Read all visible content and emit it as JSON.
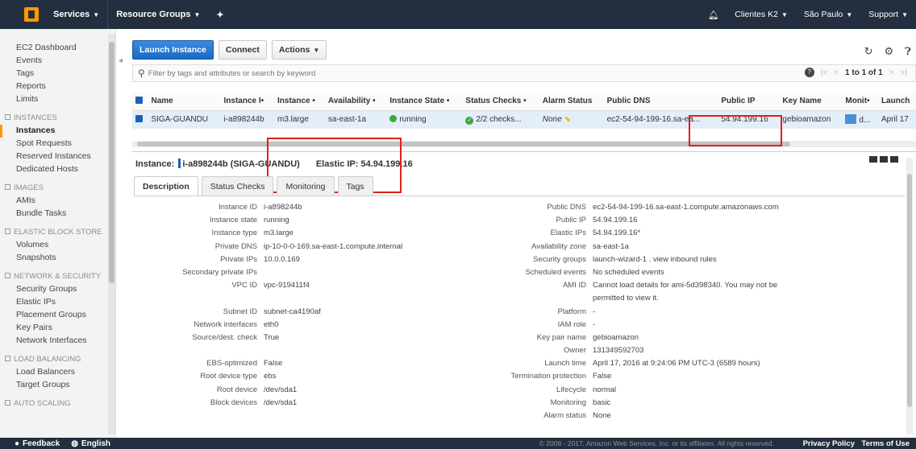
{
  "topbar": {
    "services": "Services",
    "resource_groups": "Resource Groups",
    "account": "Clientes K2",
    "region": "São Paulo",
    "support": "Support"
  },
  "sidebar": {
    "items": [
      {
        "label": "EC2 Dashboard",
        "type": "item"
      },
      {
        "label": "Events",
        "type": "item"
      },
      {
        "label": "Tags",
        "type": "item"
      },
      {
        "label": "Reports",
        "type": "item"
      },
      {
        "label": "Limits",
        "type": "item"
      },
      {
        "label": "INSTANCES",
        "type": "section"
      },
      {
        "label": "Instances",
        "type": "active"
      },
      {
        "label": "Spot Requests",
        "type": "item"
      },
      {
        "label": "Reserved Instances",
        "type": "item"
      },
      {
        "label": "Dedicated Hosts",
        "type": "item"
      },
      {
        "label": "IMAGES",
        "type": "section"
      },
      {
        "label": "AMIs",
        "type": "item"
      },
      {
        "label": "Bundle Tasks",
        "type": "item"
      },
      {
        "label": "ELASTIC BLOCK STORE",
        "type": "section"
      },
      {
        "label": "Volumes",
        "type": "item"
      },
      {
        "label": "Snapshots",
        "type": "item"
      },
      {
        "label": "NETWORK & SECURITY",
        "type": "section"
      },
      {
        "label": "Security Groups",
        "type": "item"
      },
      {
        "label": "Elastic IPs",
        "type": "item"
      },
      {
        "label": "Placement Groups",
        "type": "item"
      },
      {
        "label": "Key Pairs",
        "type": "item"
      },
      {
        "label": "Network Interfaces",
        "type": "item"
      },
      {
        "label": "LOAD BALANCING",
        "type": "section"
      },
      {
        "label": "Load Balancers",
        "type": "item"
      },
      {
        "label": "Target Groups",
        "type": "item"
      },
      {
        "label": "AUTO SCALING",
        "type": "section"
      }
    ]
  },
  "toolbar": {
    "launch": "Launch Instance",
    "connect": "Connect",
    "actions": "Actions"
  },
  "filter": {
    "placeholder": "Filter by tags and attributes or search by keyword",
    "pager": "1 to 1 of 1"
  },
  "table": {
    "headers": [
      "Name",
      "Instance I•",
      "Instance •",
      "Availability •",
      "Instance State •",
      "Status Checks •",
      "Alarm Status",
      "Public DNS",
      "Public IP",
      "Key Name",
      "Monit•",
      "Launch"
    ],
    "row": {
      "name": "SIGA-GUANDU",
      "instance_id": "i-a898244b",
      "instance_type": "m3.large",
      "az": "sa-east-1a",
      "state": "running",
      "status_checks": "2/2 checks...",
      "alarm": "None",
      "public_dns": "ec2-54-94-199-16.sa-ea...",
      "public_ip": "54.94.199.16",
      "key_name": "gebioamazon",
      "monitoring": "d...",
      "launch": "April 17"
    }
  },
  "detail": {
    "instance_label": "Instance:",
    "instance_value": "i-a898244b (SIGA-GUANDU)",
    "elastic_ip": "Elastic IP: 54.94.199.16",
    "tabs": [
      "Description",
      "Status Checks",
      "Monitoring",
      "Tags"
    ],
    "left": [
      {
        "label": "Instance ID",
        "value": "i-a898244b"
      },
      {
        "label": "Instance state",
        "value": "running"
      },
      {
        "label": "Instance type",
        "value": "m3.large"
      },
      {
        "label": "Private DNS",
        "value": "ip-10-0-0-169.sa-east-1.compute.internal"
      },
      {
        "label": "Private IPs",
        "value": "10.0.0.169"
      },
      {
        "label": "Secondary private IPs",
        "value": ""
      },
      {
        "label": "VPC ID",
        "value": "vpc-919411f4"
      },
      {
        "label": "",
        "value": ""
      },
      {
        "label": "Subnet ID",
        "value": "subnet-ca4190af"
      },
      {
        "label": "Network interfaces",
        "value": "eth0",
        "link": true
      },
      {
        "label": "Source/dest. check",
        "value": "True"
      },
      {
        "label": "",
        "value": ""
      },
      {
        "label": "EBS-optimized",
        "value": "False"
      },
      {
        "label": "Root device type",
        "value": "ebs"
      },
      {
        "label": "Root device",
        "value": "/dev/sda1",
        "link": true
      },
      {
        "label": "Block devices",
        "value": "/dev/sda1",
        "link": true
      }
    ],
    "right": [
      {
        "label": "Public DNS",
        "value": "ec2-54-94-199-16.sa-east-1.compute.amazonaws.com"
      },
      {
        "label": "Public IP",
        "value": "54.94.199.16",
        "link": true
      },
      {
        "label": "Elastic IPs",
        "value": "54.94.199.16*",
        "link": true
      },
      {
        "label": "Availability zone",
        "value": "sa-east-1a"
      },
      {
        "label": "Security groups",
        "value": "launch-wizard-1 . view inbound rules",
        "link": true
      },
      {
        "label": "Scheduled events",
        "value": "No scheduled events",
        "link": true
      },
      {
        "label": "AMI ID",
        "value": "Cannot load details for ami-5d398340. You may not be"
      },
      {
        "label": "",
        "value": "permitted to view it."
      },
      {
        "label": "Platform",
        "value": "-"
      },
      {
        "label": "IAM role",
        "value": "-"
      },
      {
        "label": "Key pair name",
        "value": "gebioamazon"
      },
      {
        "label": "Owner",
        "value": "131349592703"
      },
      {
        "label": "Launch time",
        "value": "April 17, 2016 at 9:24:06 PM UTC-3 (6589 hours)"
      },
      {
        "label": "Termination protection",
        "value": "False"
      },
      {
        "label": "Lifecycle",
        "value": "normal"
      },
      {
        "label": "Monitoring",
        "value": "basic"
      },
      {
        "label": "Alarm status",
        "value": "None"
      }
    ]
  },
  "footer": {
    "feedback": "Feedback",
    "language": "English",
    "copyright": "© 2008 - 2017, Amazon Web Services, Inc. or its affiliates. All rights reserved.",
    "privacy": "Privacy Policy",
    "terms": "Terms of Use"
  }
}
